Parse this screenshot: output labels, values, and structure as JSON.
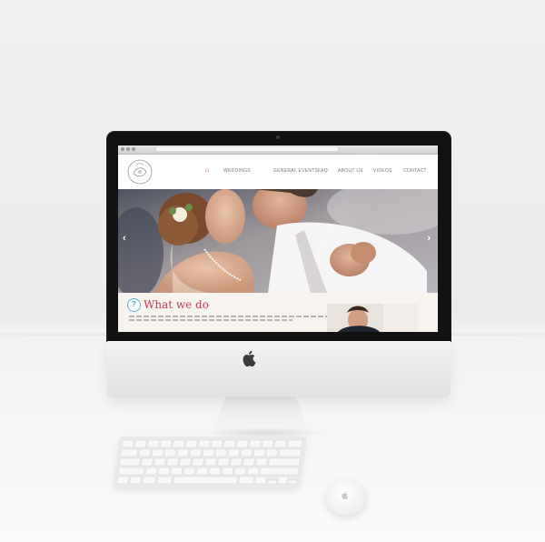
{
  "site": {
    "nav": [
      "HOME",
      "WEDDINGS",
      "GENERAL EVENTS",
      "FAQ",
      "ABOUT US",
      "VIDEOS",
      "CONTACT"
    ],
    "section_title": "What we do"
  },
  "icons": {
    "home": "home-icon",
    "slider_prev": "chevron-left-icon",
    "slider_next": "chevron-right-icon",
    "section_badge": "question-icon",
    "device_logo": "apple-logo-icon"
  },
  "colors": {
    "accent": "#d03a5a",
    "badge": "#3fa0c9",
    "bezel": "#121212"
  }
}
